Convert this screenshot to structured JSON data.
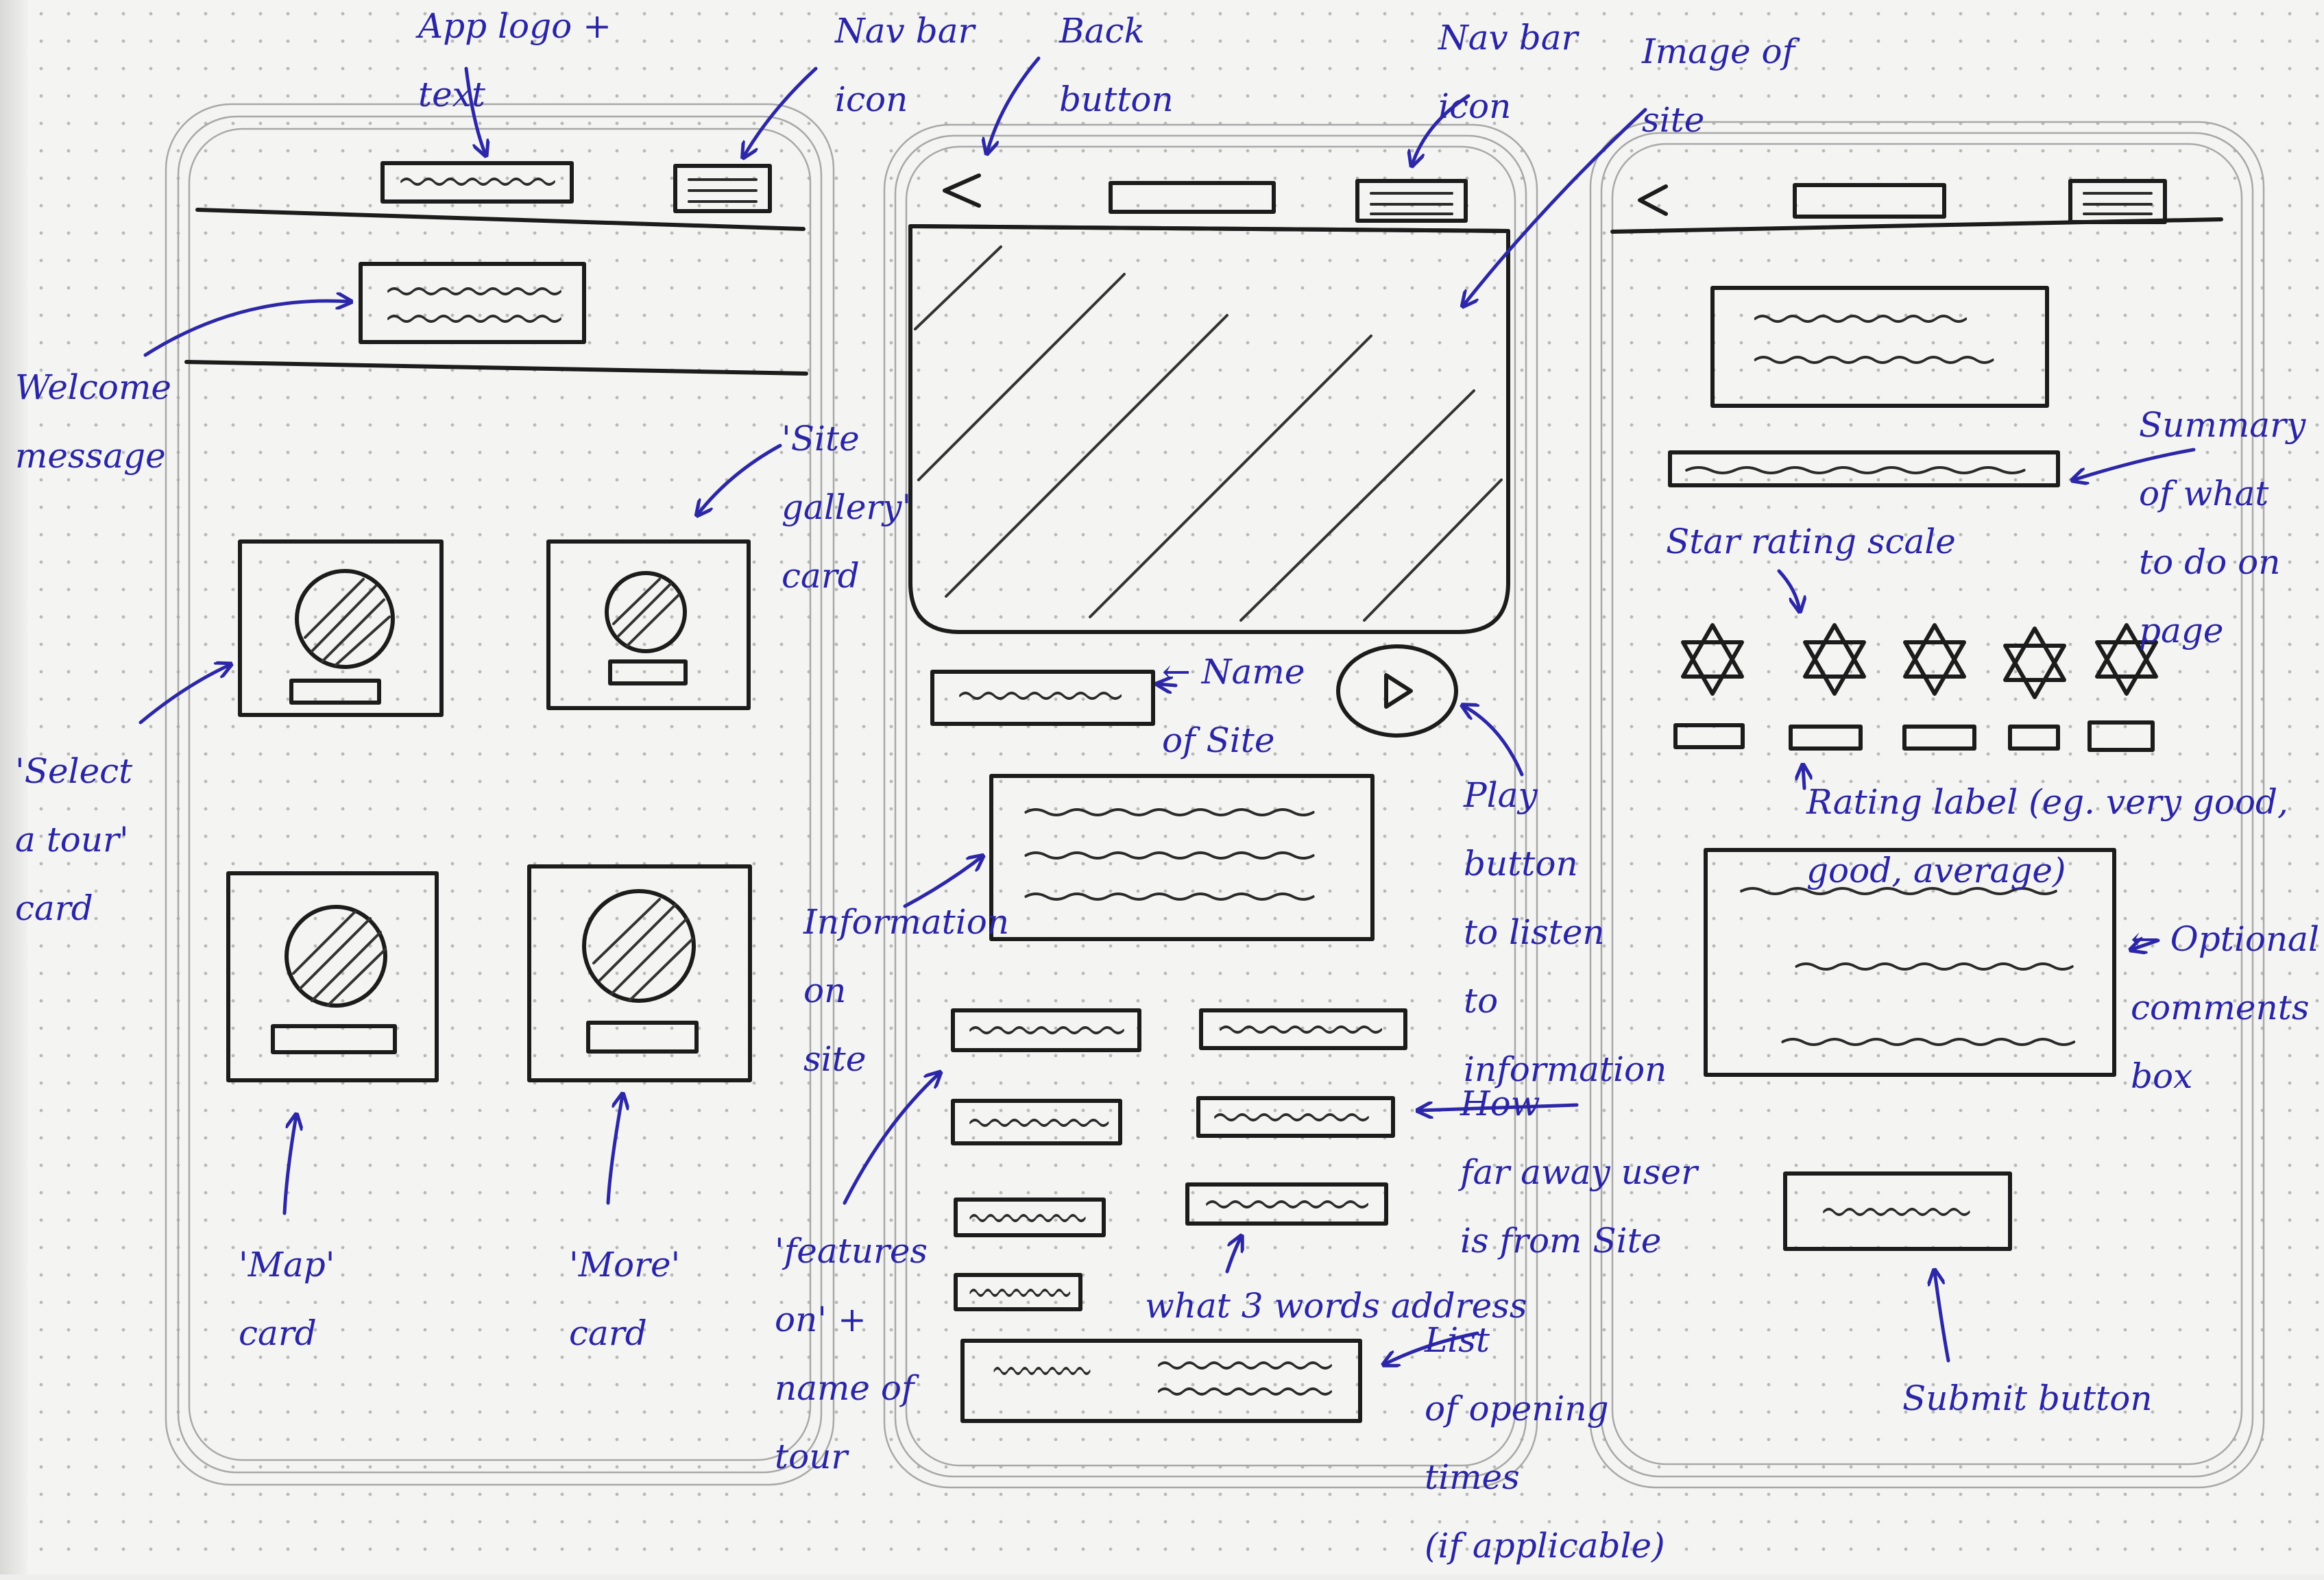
{
  "labels": {
    "app_logo": "App logo +\ntext",
    "nav_icon_1": "Nav bar\nicon",
    "back_button": "Back\nbutton",
    "nav_icon_2": "Nav bar\nicon",
    "image_of_site": "Image of\nsite",
    "welcome": "Welcome\nmessage",
    "site_gallery": "'Site\ngallery'\ncard",
    "select_tour": "'Select\na tour'\ncard",
    "map_card": "'Map'\ncard",
    "more_card": "'More'\ncard",
    "name_of_site": "← Name\nof Site",
    "play_button": "Play\nbutton\nto listen\nto\ninformation",
    "information": "Information\non\nsite",
    "how_far": "How\nfar away user\nis from Site",
    "features_on": "'features\non' +\nname of\ntour",
    "what3words": "what 3 words address",
    "opening_times": "List\nof opening\ntimes\n(if applicable)",
    "summary": "Summary\nof what\nto do on\npage",
    "star_scale": "Star rating scale",
    "rating_label": "Rating label (eg. very good,\ngood, average)",
    "comments": "← Optional\ncomments\nbox",
    "submit": "Submit button"
  },
  "rating_count": 5,
  "colors": {
    "ink": "#1c1c1c",
    "pen": "#2c27a8",
    "paper": "#f4f4f2"
  }
}
